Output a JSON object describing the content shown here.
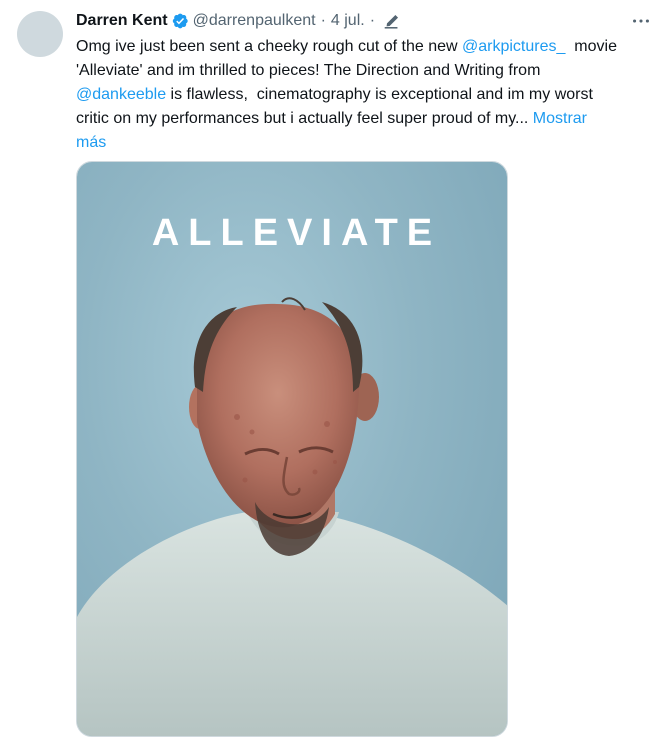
{
  "tweet": {
    "display_name": "Darren Kent",
    "handle": "@darrenpaulkent",
    "separator": "·",
    "date": "4 jul.",
    "separator2": "·",
    "more_label": "···",
    "verified_icon": "verified-badge-icon",
    "edited_icon": "pencil-edit-icon",
    "text": {
      "l1_a": "Omg ive just been sent a cheeky rough cut of the new ",
      "l1_mention": "@arkpictures_",
      "l1_b": "  movie",
      "l2": "'Alleviate' and im thrilled to pieces! The Direction and Writing from",
      "l3_mention": "@dankeeble",
      "l3_b": " is flawless,  cinematography is exceptional and im my worst",
      "l4": "critic on my performances but i actually feel super proud of my... ",
      "show_more_1": "Mostrar",
      "show_more_2": "más"
    },
    "media": {
      "poster_title": "ALLEVIATE"
    }
  },
  "colors": {
    "link": "#1d9bf0",
    "secondary_text": "#536471",
    "verified": "#1d9bf0",
    "avatar_placeholder": "#cfd9de"
  }
}
